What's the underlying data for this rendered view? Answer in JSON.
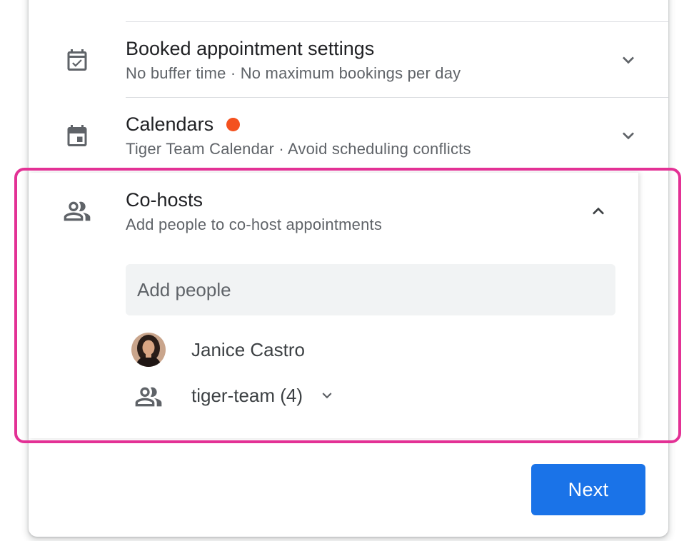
{
  "sections": {
    "booked": {
      "title": "Booked appointment settings",
      "subtitle": "No buffer time · No maximum bookings per day",
      "icon": "event-available-icon",
      "expanded": false
    },
    "calendars": {
      "title": "Calendars",
      "subtitle": "Tiger Team Calendar · Avoid scheduling conflicts",
      "icon": "event-icon",
      "status_dot_color": "#f4511e",
      "expanded": false
    },
    "cohosts": {
      "title": "Co-hosts",
      "subtitle": "Add people to co-host appointments",
      "icon": "people-outline-icon",
      "expanded": true,
      "add_people_placeholder": "Add people",
      "people": [
        {
          "name": "Janice Castro",
          "icon": "avatar-photo"
        },
        {
          "name": "tiger-team (4)",
          "icon": "people-outline-icon"
        }
      ]
    }
  },
  "actions": {
    "next_label": "Next"
  },
  "colors": {
    "primary": "#1a73e8",
    "highlight": "#e33195",
    "text_primary": "#202124",
    "text_secondary": "#5f6368",
    "divider": "#dadce0"
  }
}
